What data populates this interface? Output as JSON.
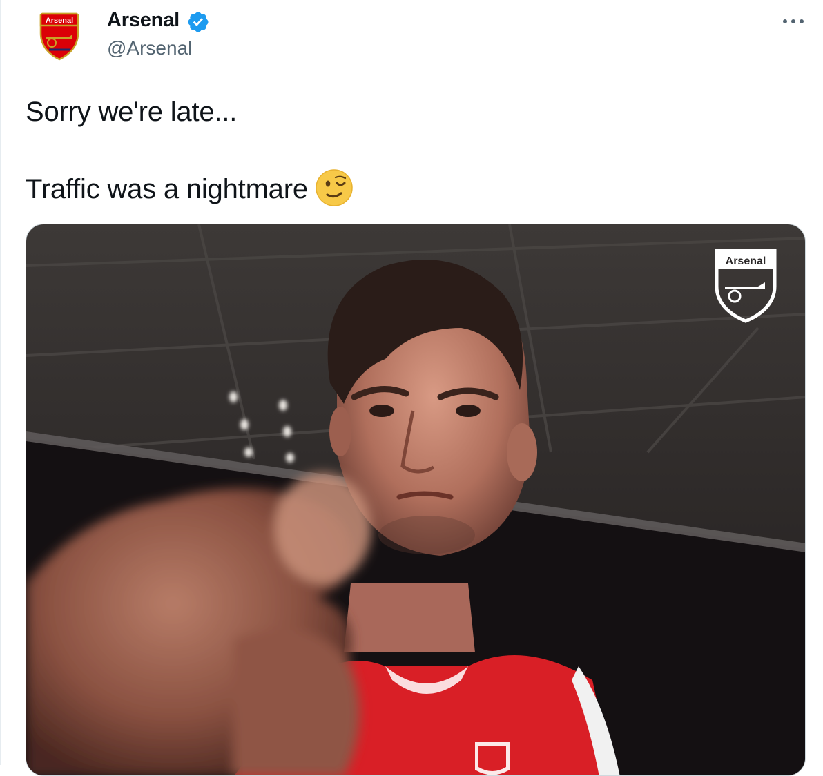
{
  "tweet": {
    "display_name": "Arsenal",
    "handle": "@Arsenal",
    "avatar_icon": "arsenal-crest-icon",
    "avatar_text": "Arsenal",
    "verified_icon": "verified-badge-icon",
    "more_icon": "more-options-icon",
    "text_line_1": "Sorry we're late...",
    "text_line_2": "Traffic was a nightmare",
    "emoji": "winking-face-emoji"
  },
  "media": {
    "type": "video",
    "watermark_text": "Arsenal"
  },
  "colors": {
    "verified_blue": "#1d9bf0",
    "arsenal_red": "#db0007",
    "handle_gray": "#536471",
    "text_dark": "#0f1419",
    "border": "#cfd9de"
  }
}
